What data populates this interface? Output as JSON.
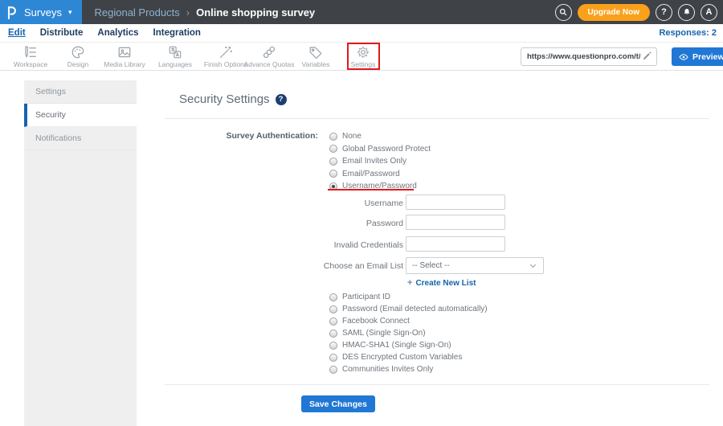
{
  "topbar": {
    "app_menu": "Surveys",
    "caret": "▾",
    "breadcrumb": {
      "parent": "Regional Products",
      "separator": "›",
      "current": "Online shopping survey"
    },
    "upgrade_label": "Upgrade Now",
    "help_label": "?",
    "avatar_label": "A"
  },
  "nav": {
    "items": [
      {
        "label": "Edit"
      },
      {
        "label": "Distribute"
      },
      {
        "label": "Analytics"
      },
      {
        "label": "Integration"
      }
    ],
    "responses": "Responses: 2"
  },
  "toolbar": {
    "items": [
      {
        "label": "Workspace"
      },
      {
        "label": "Design"
      },
      {
        "label": "Media Library"
      },
      {
        "label": "Languages"
      },
      {
        "label": "Finish Options"
      },
      {
        "label": "Advance Quotas"
      },
      {
        "label": "Variables"
      },
      {
        "label": "Settings"
      }
    ],
    "survey_url": "https://www.questionpro.com/t/APNrFZ",
    "preview_label": "Preview"
  },
  "sidebar": {
    "items": [
      {
        "label": "Settings"
      },
      {
        "label": "Security"
      },
      {
        "label": "Notifications"
      }
    ]
  },
  "main": {
    "title": "Security Settings",
    "help_glyph": "?",
    "auth_label": "Survey Authentication:",
    "auth_options_top": [
      "None",
      "Global Password Protect",
      "Email Invites Only",
      "Email/Password",
      "Username/Password"
    ],
    "selected_option": "Username/Password",
    "fields": [
      {
        "label": "Username",
        "value": ""
      },
      {
        "label": "Password",
        "value": ""
      },
      {
        "label": "Invalid Credentials",
        "value": ""
      }
    ],
    "email_list": {
      "label": "Choose an Email List",
      "selected": "-- Select --"
    },
    "create_new_list": "Create New List",
    "plus_glyph": "+",
    "auth_options_bottom": [
      "Participant ID",
      "Password (Email detected automatically)",
      "Facebook Connect",
      "SAML (Single Sign-On)",
      "HMAC-SHA1 (Single Sign-On)",
      "DES Encrypted Custom Variables",
      "Communities Invites Only"
    ],
    "save_label": "Save Changes"
  },
  "colors": {
    "topbar_gray": "#3f4247",
    "brand_blue": "#2d87d5",
    "link_blue": "#1464ad",
    "button_blue": "#2077d4",
    "upgrade_orange": "#f9a11b",
    "annotation_red": "#e0191f",
    "sidebar_gray": "#efefef"
  }
}
